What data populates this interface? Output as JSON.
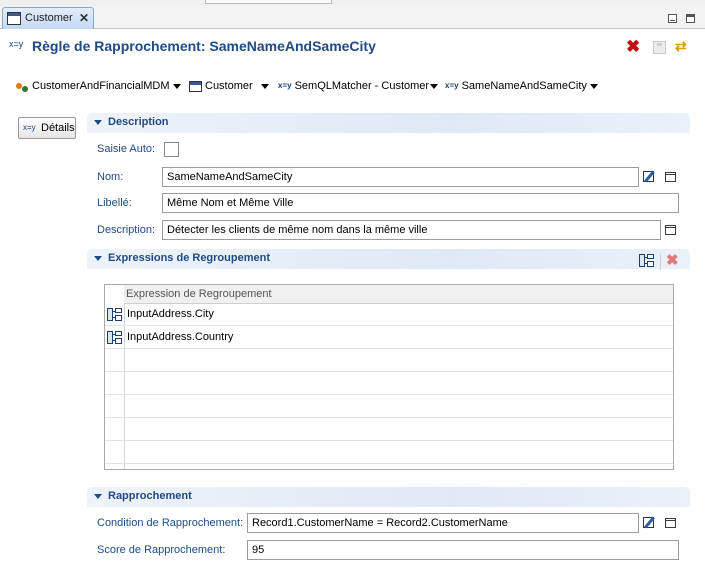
{
  "tab": {
    "title": "Customer"
  },
  "header": {
    "icon_text": "x=y",
    "title": "Règle de Rapprochement: SameNameAndSameCity"
  },
  "breadcrumb": {
    "items": [
      {
        "label": "CustomerAndFinancialMDM",
        "icon": "model-icon"
      },
      {
        "label": "Customer",
        "icon": "entity-icon"
      },
      {
        "label": "SemQLMatcher - Customer",
        "icon": "matcher-icon"
      },
      {
        "label": "SameNameAndSameCity",
        "icon": "xy-icon"
      }
    ]
  },
  "details_button": {
    "icon_text": "x=y",
    "label": "Détails"
  },
  "description_section": {
    "title": "Description",
    "auto_label": "Saisie Auto:",
    "name_label": "Nom:",
    "name_value": "SameNameAndSameCity",
    "libelle_label": "Libellé:",
    "libelle_value": "Même Nom et Même Ville",
    "description_label": "Description:",
    "description_value": "Détecter les clients de même nom dans la même ville"
  },
  "grouping_section": {
    "title": "Expressions de Regroupement",
    "column_header": "Expression de Regroupement",
    "rows": [
      "InputAddress.City",
      "InputAddress.Country"
    ]
  },
  "matching_section": {
    "title": "Rapprochement",
    "condition_label": "Condition de Rapprochement:",
    "condition_value": "Record1.CustomerName = Record2.CustomerName",
    "score_label": "Score de Rapprochement:",
    "score_value": "95"
  },
  "colors": {
    "title_blue": "#1f4b84",
    "delete_red": "#c01010"
  }
}
